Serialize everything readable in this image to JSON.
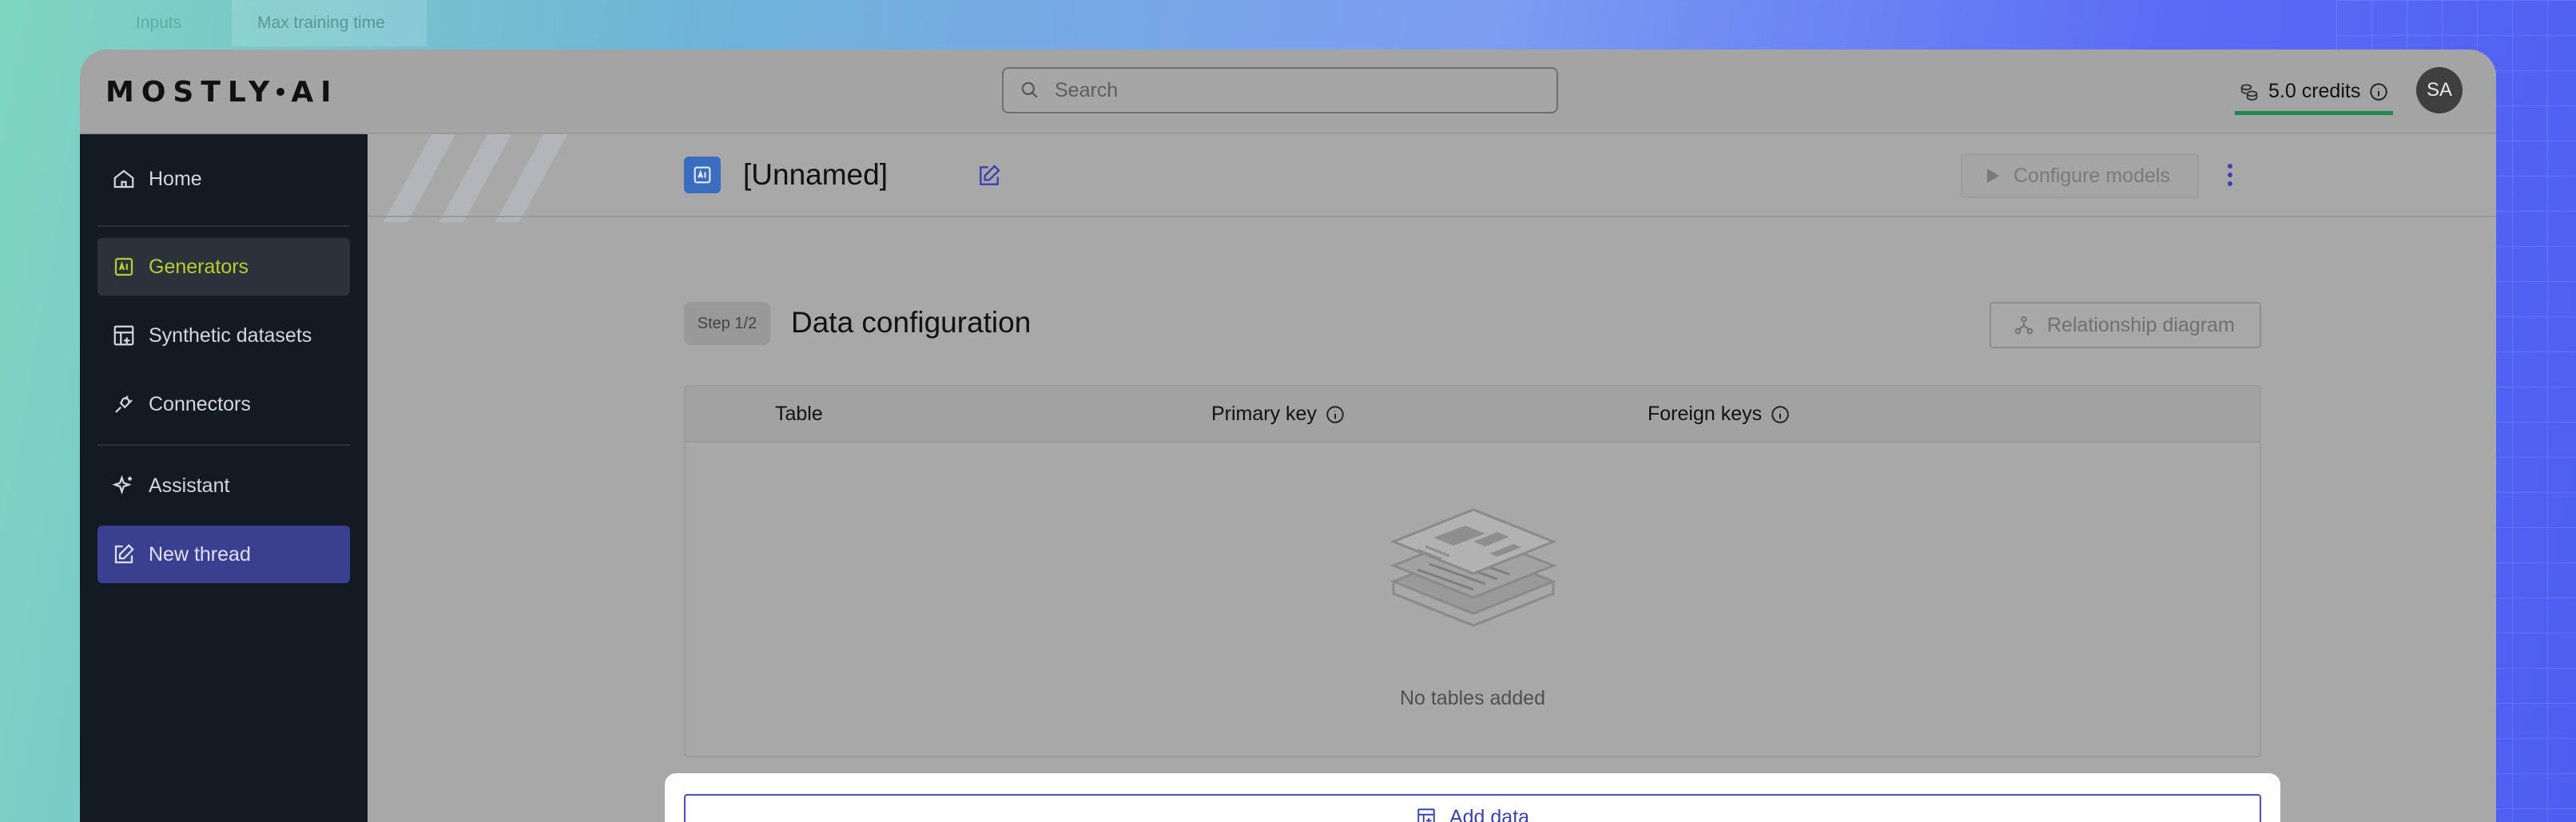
{
  "background": {
    "ghost_tab_left": "Inputs",
    "ghost_tab": "Max training time"
  },
  "header": {
    "logo": "MOSTLY AI",
    "search_placeholder": "Search",
    "credits": "5.0 credits",
    "avatar_initials": "SA"
  },
  "sidebar": {
    "items": [
      {
        "label": "Home",
        "icon": "home-icon"
      },
      {
        "label": "Generators",
        "icon": "generator-icon"
      },
      {
        "label": "Synthetic datasets",
        "icon": "dataset-icon"
      },
      {
        "label": "Connectors",
        "icon": "plug-icon"
      },
      {
        "label": "Assistant",
        "icon": "sparkle-icon"
      },
      {
        "label": "New thread",
        "icon": "edit-icon"
      }
    ]
  },
  "main": {
    "generator_name": "[Unnamed]",
    "configure_button": "Configure models",
    "step_badge": "Step 1/2",
    "section_title": "Data configuration",
    "relationship_button": "Relationship diagram",
    "table": {
      "columns": [
        "Table",
        "Primary key",
        "Foreign keys"
      ],
      "empty_text": "No tables added"
    },
    "add_data_button": "Add data"
  },
  "colors": {
    "sidebar_bg": "#141a24",
    "active_generator_text": "#b9cc2e",
    "new_thread_bg": "#3a3f8f",
    "accent_blue": "#3a42b0",
    "credits_underline": "#1c8a50"
  }
}
